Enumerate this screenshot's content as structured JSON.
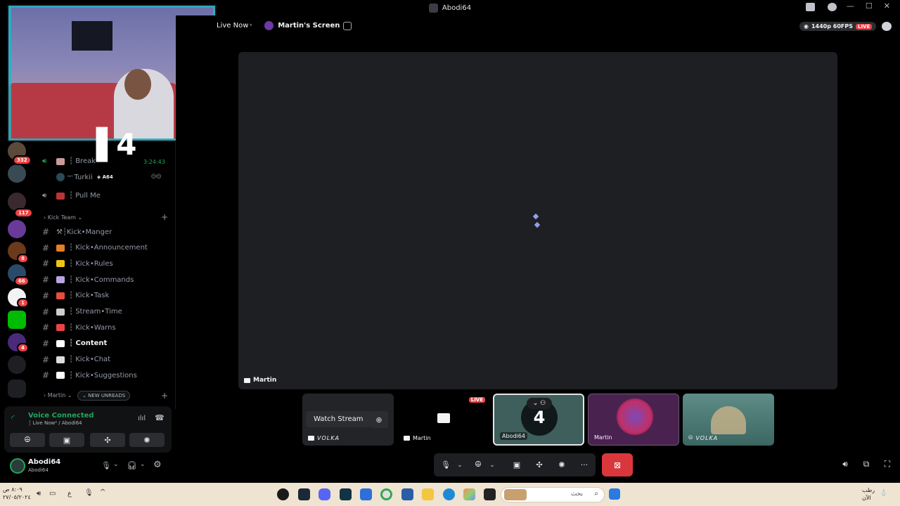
{
  "window": {
    "title": "Abodi64"
  },
  "header": {
    "live_channel": "Live Now",
    "live_channel_suffix": "²",
    "screen_title": "Martin's Screen",
    "quality": "1440p 60FPS",
    "live_badge": "LIVE"
  },
  "servers": {
    "badges": [
      "332",
      "117",
      "8",
      "66",
      "1",
      "4"
    ]
  },
  "voice_channels": [
    {
      "name": "┆ Break",
      "time": "3:24:43"
    },
    {
      "name": "Turkii",
      "prefix": "ᴿᴷᵀ",
      "tag": "A64"
    },
    {
      "name": "┆ Pull Me"
    }
  ],
  "categories": {
    "kick_team": "Kick Team",
    "martin": "Martin",
    "new_unreads": "NEW UNREADS"
  },
  "text_channels": [
    {
      "name": "⚒┆Kick•Manger",
      "bold": false
    },
    {
      "name": "┆ Kick•Announcement",
      "bold": false
    },
    {
      "name": "┆ Kick•Rules",
      "bold": false
    },
    {
      "name": "┆ Kick•Commands",
      "bold": false
    },
    {
      "name": "┆ Kick•Task",
      "bold": false
    },
    {
      "name": "┆ Stream•Time",
      "bold": false
    },
    {
      "name": "┆ Kick•Warns",
      "bold": false
    },
    {
      "name": "┆ Content",
      "bold": true
    },
    {
      "name": "┆ Kick•Chat",
      "bold": false
    },
    {
      "name": "┆ Kick•Suggestions",
      "bold": false
    }
  ],
  "channel_emoji_colors": [
    "#aaaaaa",
    "#e67e22",
    "#f1c40f",
    "#b9a3e3",
    "#e74c3c",
    "#cccccc",
    "#ed4245",
    "#ffffff",
    "#dddddd",
    "#ffffff"
  ],
  "voice": {
    "status": "Voice Connected",
    "location": "┆ Live Now² / Abodi64"
  },
  "user": {
    "name": "Abodi64",
    "status": "Abodi64"
  },
  "stage": {
    "main_label": "Martin"
  },
  "tiles": [
    {
      "label": "VOLKA",
      "watch_label": "Watch Stream"
    },
    {
      "label": "Martin",
      "live": "LIVE"
    },
    {
      "label": "Abodi64"
    },
    {
      "label": "Martin"
    },
    {
      "label": "VOLKA"
    }
  ],
  "taskbar": {
    "search_placeholder": "بحث",
    "clock_line1": "٨:٠٩ ص",
    "clock_line2": "٢٧/٠٥/٢٠٢٤",
    "lang": "ع",
    "weather_line1": "رطب",
    "weather_line2": "الآن"
  },
  "colors": {
    "accent_green": "#23a55a",
    "danger": "#ed4245",
    "leave": "#da373c"
  }
}
